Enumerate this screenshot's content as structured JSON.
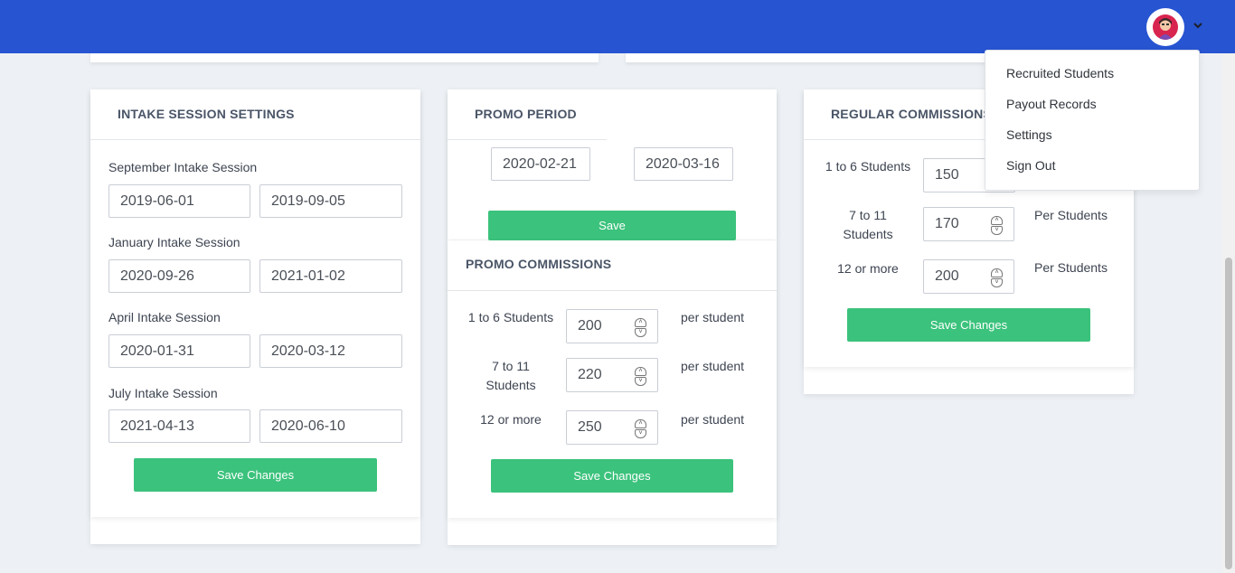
{
  "user_menu": {
    "items": [
      "Recruited Students",
      "Payout Records",
      "Settings",
      "Sign Out"
    ]
  },
  "intake": {
    "title": "INTAKE SESSION SETTINGS",
    "sessions": [
      {
        "label": "September Intake Session",
        "start": "2019-06-01",
        "end": "2019-09-05"
      },
      {
        "label": "January Intake Session",
        "start": "2020-09-26",
        "end": "2021-01-02"
      },
      {
        "label": "April Intake Session",
        "start": "2020-01-31",
        "end": "2020-03-12"
      },
      {
        "label": "July Intake Session",
        "start": "2021-04-13",
        "end": "2020-06-10"
      }
    ],
    "save_label": "Save Changes"
  },
  "promo_period": {
    "title": "PROMO PERIOD",
    "start": "2020-02-21",
    "end": "2020-03-16",
    "save_label": "Save"
  },
  "promo_commissions": {
    "title": "PROMO COMMISSIONS",
    "tiers": [
      {
        "label": "1 to 6 Students",
        "value": "200",
        "unit": "per student"
      },
      {
        "label": "7 to 11 Students",
        "value": "220",
        "unit": "per student"
      },
      {
        "label": "12 or more",
        "value": "250",
        "unit": "per student"
      }
    ],
    "save_label": "Save Changes"
  },
  "regular_commissions": {
    "title": "REGULAR COMMISSIONS",
    "tiers": [
      {
        "label": "1 to 6 Students",
        "value": "150",
        "unit": ""
      },
      {
        "label": "7 to 11 Students",
        "value": "170",
        "unit": "Per Students"
      },
      {
        "label": "12 or more",
        "value": "200",
        "unit": "Per Students"
      }
    ],
    "save_label": "Save Changes"
  },
  "colors": {
    "topbar": "#2754d1",
    "button": "#3bc27c",
    "background": "#edf1f5"
  }
}
